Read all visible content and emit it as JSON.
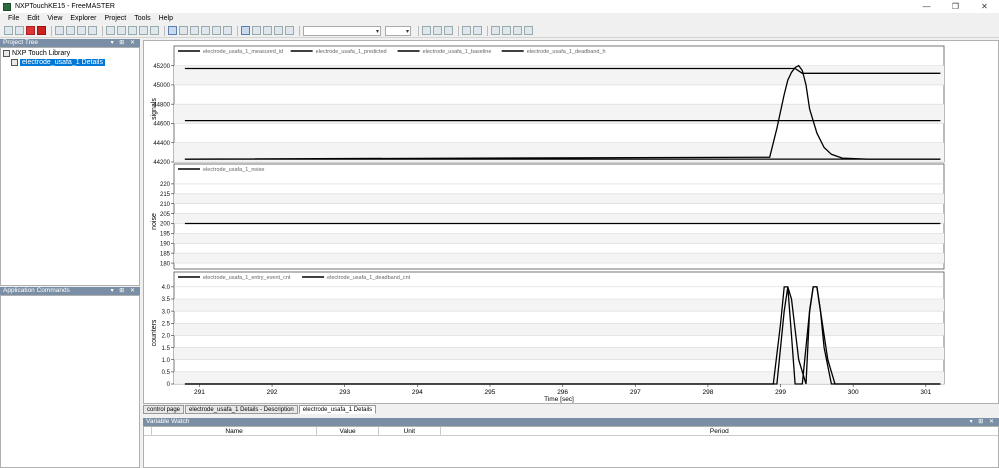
{
  "window": {
    "title": "NXPTouchKE15 - FreeMASTER"
  },
  "menu": [
    "File",
    "Edit",
    "View",
    "Explorer",
    "Project",
    "Tools",
    "Help"
  ],
  "project_tree": {
    "header": "Project Tree",
    "root": "NXP Touch Library",
    "child": "electrode_usafa_1 Details"
  },
  "app_commands": {
    "header": "Application Commands"
  },
  "tabs": [
    "control page",
    "electrode_usafa_1 Details - Description",
    "electrode_usafa_1 Details"
  ],
  "watch": {
    "header": "Variable Watch",
    "columns": [
      "Name",
      "Value",
      "Unit",
      "Period"
    ]
  },
  "chart_data": [
    {
      "type": "line",
      "ylabel": "signals",
      "ylim": [
        44200,
        45300
      ],
      "yticks": [
        45200,
        45000,
        44800,
        44600,
        44400,
        44200
      ],
      "series": [
        {
          "name": "electrode_usafa_1_measured_id",
          "x": [
            290.8,
            298.85,
            298.95,
            299.05,
            299.1,
            299.15,
            299.2,
            299.25,
            299.3,
            299.35,
            299.4,
            299.5,
            299.6,
            299.7,
            299.85,
            300.2,
            301.2
          ],
          "y": [
            44230,
            44250,
            44550,
            44900,
            45050,
            45130,
            45180,
            45200,
            45150,
            45000,
            44750,
            44500,
            44350,
            44280,
            44240,
            44230,
            44230
          ]
        },
        {
          "name": "electrode_usafa_1_predicted",
          "x": [
            290.8,
            301.2
          ],
          "y": [
            44230,
            44230
          ]
        },
        {
          "name": "electrode_usafa_1_baseline",
          "x": [
            290.8,
            301.2
          ],
          "y": [
            44630,
            44630
          ]
        },
        {
          "name": "electrode_usafa_1_deadband_h",
          "x": [
            290.8,
            299.2,
            299.3,
            301.2
          ],
          "y": [
            45170,
            45170,
            45120,
            45120
          ]
        }
      ]
    },
    {
      "type": "line",
      "ylabel": "noise",
      "ylim": [
        177,
        225
      ],
      "yticks": [
        220,
        215,
        210,
        205,
        200,
        195,
        190,
        185,
        180
      ],
      "series": [
        {
          "name": "electrode_usafa_1_noise",
          "x": [
            290.8,
            301.2
          ],
          "y": [
            200,
            200
          ]
        }
      ]
    },
    {
      "type": "line",
      "xlabel": "Time [sec]",
      "ylabel": "counters",
      "ylim": [
        0,
        4.2
      ],
      "yticks": [
        4.0,
        3.5,
        3.0,
        2.5,
        2.0,
        1.5,
        1.0,
        0.5,
        0
      ],
      "xticks": [
        291,
        292,
        293,
        294,
        295,
        296,
        297,
        298,
        299,
        300,
        301
      ],
      "xlim": [
        290.65,
        301.25
      ],
      "series": [
        {
          "name": "electrode_usafa_1_entry_event_cnt",
          "x": [
            290.8,
            298.9,
            299.0,
            299.05,
            299.1,
            299.15,
            299.2,
            299.3,
            299.4,
            299.45,
            299.5,
            299.55,
            299.6,
            299.7,
            301.2
          ],
          "y": [
            0,
            0,
            2.5,
            4,
            4,
            2,
            0,
            0,
            3,
            4,
            4,
            3,
            1.5,
            0,
            0
          ]
        },
        {
          "name": "electrode_usafa_1_deadband_cnt",
          "x": [
            290.8,
            298.95,
            299.05,
            299.1,
            299.15,
            299.25,
            299.35,
            299.4,
            299.45,
            299.5,
            299.55,
            299.65,
            299.75,
            301.2
          ],
          "y": [
            0,
            0,
            3,
            4,
            3.5,
            1,
            0,
            3,
            4,
            4,
            3,
            1,
            0,
            0
          ]
        }
      ]
    }
  ]
}
